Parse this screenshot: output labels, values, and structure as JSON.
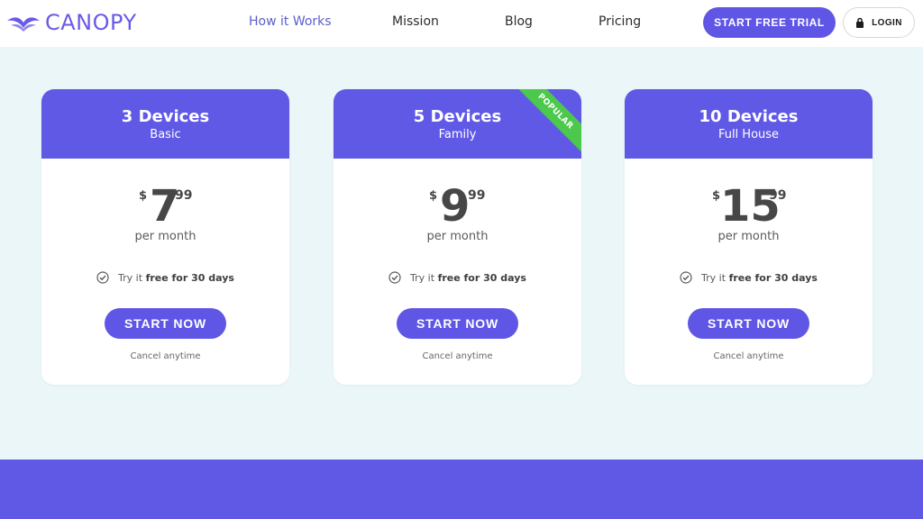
{
  "brand": {
    "name": "CANOPY",
    "color": "#6a5ae8"
  },
  "nav": {
    "links": [
      "How it Works",
      "Mission",
      "Blog",
      "Pricing"
    ],
    "active_index": 0,
    "cta_label": "START FREE TRIAL",
    "login_label": "LOGIN"
  },
  "plans": [
    {
      "title": "3 Devices",
      "subtitle": "Basic",
      "currency": "$",
      "price": "7",
      "cents": "99",
      "period": "per month",
      "trial_prefix": "Try it ",
      "trial_bold": "free for 30 days",
      "button": "START NOW",
      "note": "Cancel anytime",
      "ribbon": ""
    },
    {
      "title": "5 Devices",
      "subtitle": "Family",
      "currency": "$",
      "price": "9",
      "cents": "99",
      "period": "per month",
      "trial_prefix": "Try it ",
      "trial_bold": "free for 30 days",
      "button": "START NOW",
      "note": "Cancel anytime",
      "ribbon": "POPULAR"
    },
    {
      "title": "10 Devices",
      "subtitle": "Full House",
      "currency": "$",
      "price": "15",
      "cents": "99",
      "period": "per month",
      "trial_prefix": "Try it ",
      "trial_bold": "free for 30 days",
      "button": "START NOW",
      "note": "Cancel anytime",
      "ribbon": ""
    }
  ],
  "colors": {
    "accent": "#5f56e6",
    "header": "#6059e6",
    "background": "#eaf6f7",
    "ribbon": "#4cc94c"
  },
  "icons": {
    "logo": "canopy-wing-icon",
    "login": "lock-icon",
    "trial": "check-circle-icon"
  }
}
